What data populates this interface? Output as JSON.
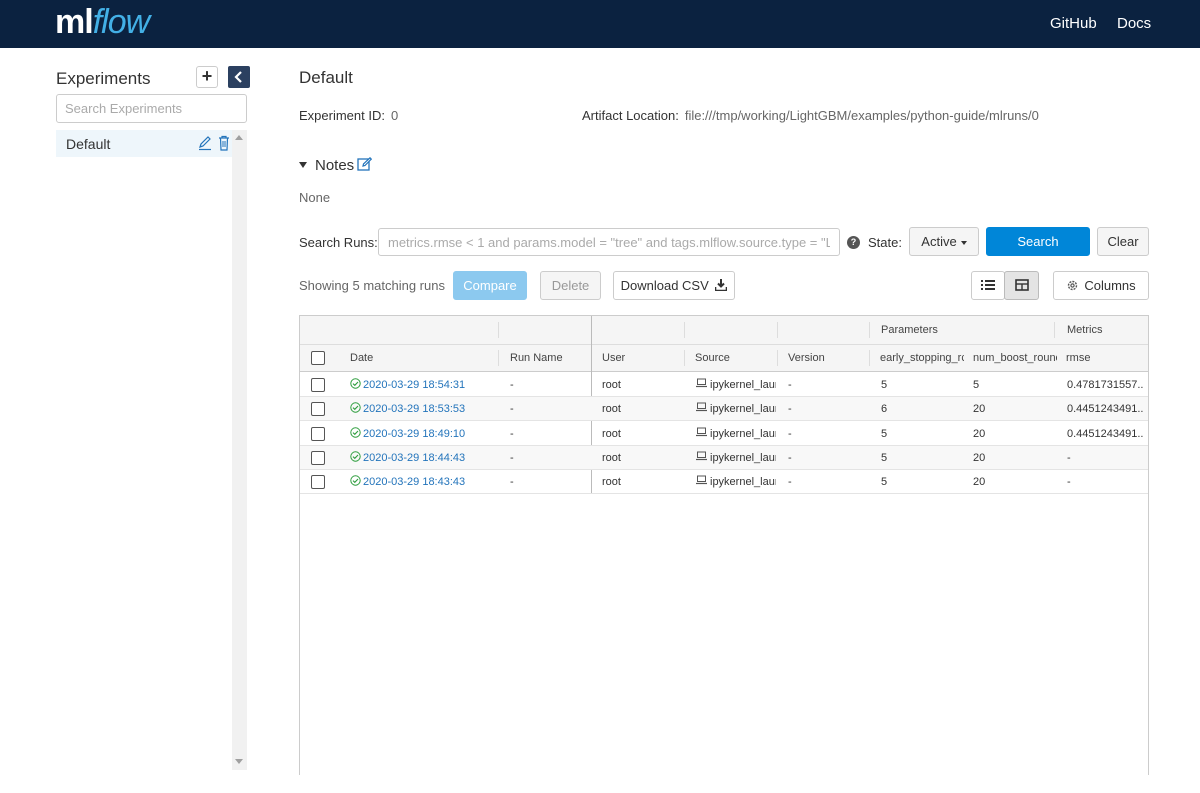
{
  "header": {
    "logo_ml": "ml",
    "logo_flow": "flow",
    "links": [
      "GitHub",
      "Docs"
    ]
  },
  "sidebar": {
    "title": "Experiments",
    "add_label": "+",
    "search_placeholder": "Search Experiments",
    "experiments": [
      {
        "name": "Default",
        "selected": true
      }
    ]
  },
  "experiment": {
    "name": "Default",
    "id_label": "Experiment ID:",
    "id_value": "0",
    "artifact_label": "Artifact Location:",
    "artifact_value": "file:///tmp/working/LightGBM/examples/python-guide/mlruns/0",
    "notes_label": "Notes",
    "notes_value": "None"
  },
  "search": {
    "label": "Search Runs:",
    "placeholder": "metrics.rmse < 1 and params.model = \"tree\" and tags.mlflow.source.type = \"LC",
    "state_label": "State:",
    "state_value": "Active",
    "search_button": "Search",
    "clear_button": "Clear"
  },
  "toolbar": {
    "showing": "Showing 5 matching runs",
    "compare": "Compare",
    "delete": "Delete",
    "download": "Download CSV",
    "columns": "Columns"
  },
  "table": {
    "groups": {
      "parameters": "Parameters",
      "metrics": "Metrics"
    },
    "columns": [
      "Date",
      "Run Name",
      "User",
      "Source",
      "Version",
      "early_stopping_rc",
      "num_boost_rounc",
      "rmse"
    ],
    "rows": [
      {
        "date": "2020-03-29 18:54:31",
        "run_name": "-",
        "user": "root",
        "source": "ipykernel_laun",
        "version": "-",
        "early_stopping": "5",
        "num_boost": "5",
        "rmse": "0.4781731557..."
      },
      {
        "date": "2020-03-29 18:53:53",
        "run_name": "-",
        "user": "root",
        "source": "ipykernel_laun",
        "version": "-",
        "early_stopping": "6",
        "num_boost": "20",
        "rmse": "0.4451243491..."
      },
      {
        "date": "2020-03-29 18:49:10",
        "run_name": "-",
        "user": "root",
        "source": "ipykernel_laun",
        "version": "-",
        "early_stopping": "5",
        "num_boost": "20",
        "rmse": "0.4451243491..."
      },
      {
        "date": "2020-03-29 18:44:43",
        "run_name": "-",
        "user": "root",
        "source": "ipykernel_laun",
        "version": "-",
        "early_stopping": "5",
        "num_boost": "20",
        "rmse": "-"
      },
      {
        "date": "2020-03-29 18:43:43",
        "run_name": "-",
        "user": "root",
        "source": "ipykernel_laun",
        "version": "-",
        "early_stopping": "5",
        "num_boost": "20",
        "rmse": "-"
      }
    ]
  },
  "icons": {
    "collapse": "chevron-left-icon",
    "edit": "pencil-icon",
    "delete": "trash-icon",
    "help": "question-circle-icon",
    "download": "download-icon",
    "list_view": "list-view-icon",
    "grid_view": "grid-view-icon",
    "columns": "gear-icon",
    "status": "check-circle-icon",
    "source": "laptop-icon"
  },
  "colors": {
    "topbar": "#0b2240",
    "brand_flow": "#43b0e6",
    "primary": "#0086d8",
    "link": "#2374bb",
    "success": "#2e9e3e"
  }
}
